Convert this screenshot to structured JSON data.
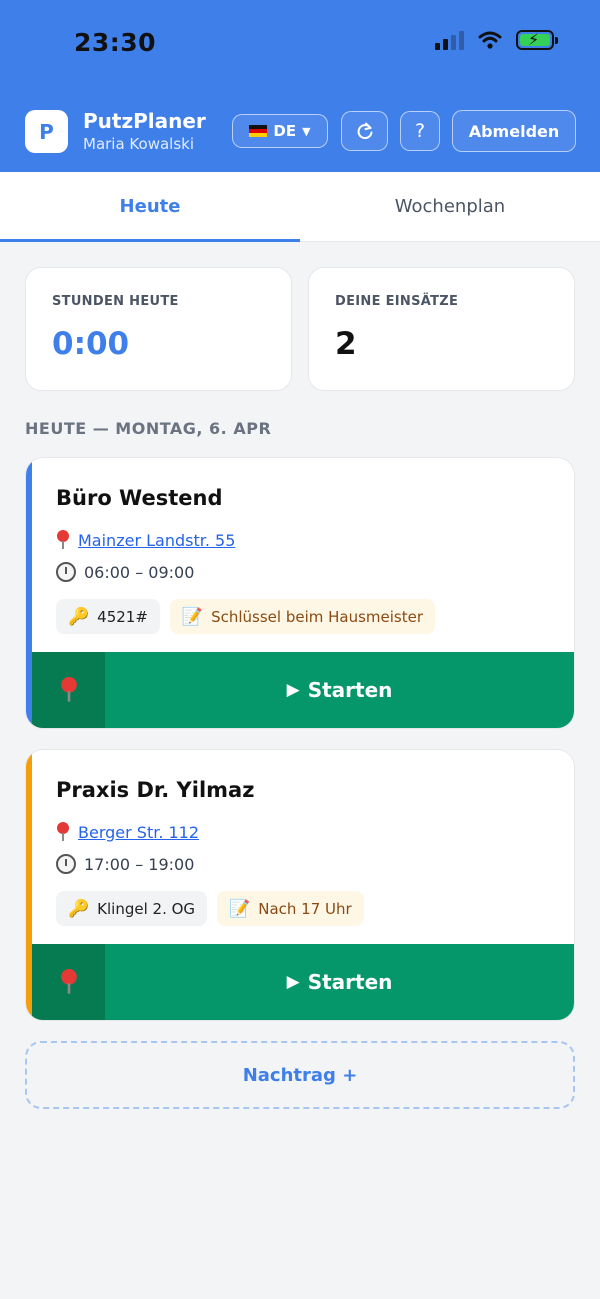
{
  "status_bar": {
    "time": "23:30"
  },
  "header": {
    "logo_letter": "P",
    "app_title": "PutzPlaner",
    "user_name": "Maria Kowalski",
    "language": "DE",
    "help_label": "?",
    "logout_label": "Abmelden",
    "brand_color": "#3f7fea"
  },
  "tabs": [
    {
      "label": "Heute",
      "active": true
    },
    {
      "label": "Wochenplan",
      "active": false
    }
  ],
  "stats": [
    {
      "label": "STUNDEN HEUTE",
      "value": "0:00",
      "color": "#3f7fea"
    },
    {
      "label": "DEINE EINSÄTZE",
      "value": "2",
      "color": "#111111"
    }
  ],
  "section_heading": "HEUTE — MONTAG, 6. APR",
  "jobs": [
    {
      "title": "Büro Westend",
      "address": "Mainzer Landstr. 55",
      "time": "06:00 – 09:00",
      "code": "4521#",
      "note": "Schlüssel beim Hausmeister",
      "accent_color": "#3f7fea",
      "start_label": "Starten"
    },
    {
      "title": "Praxis Dr. Yilmaz",
      "address": "Berger Str. 112",
      "time": "17:00 – 19:00",
      "code": "Klingel 2. OG",
      "note": "Nach 17 Uhr",
      "accent_color": "#f59e0b",
      "start_label": "Starten"
    }
  ],
  "nachtrag_label": "Nachtrag +"
}
